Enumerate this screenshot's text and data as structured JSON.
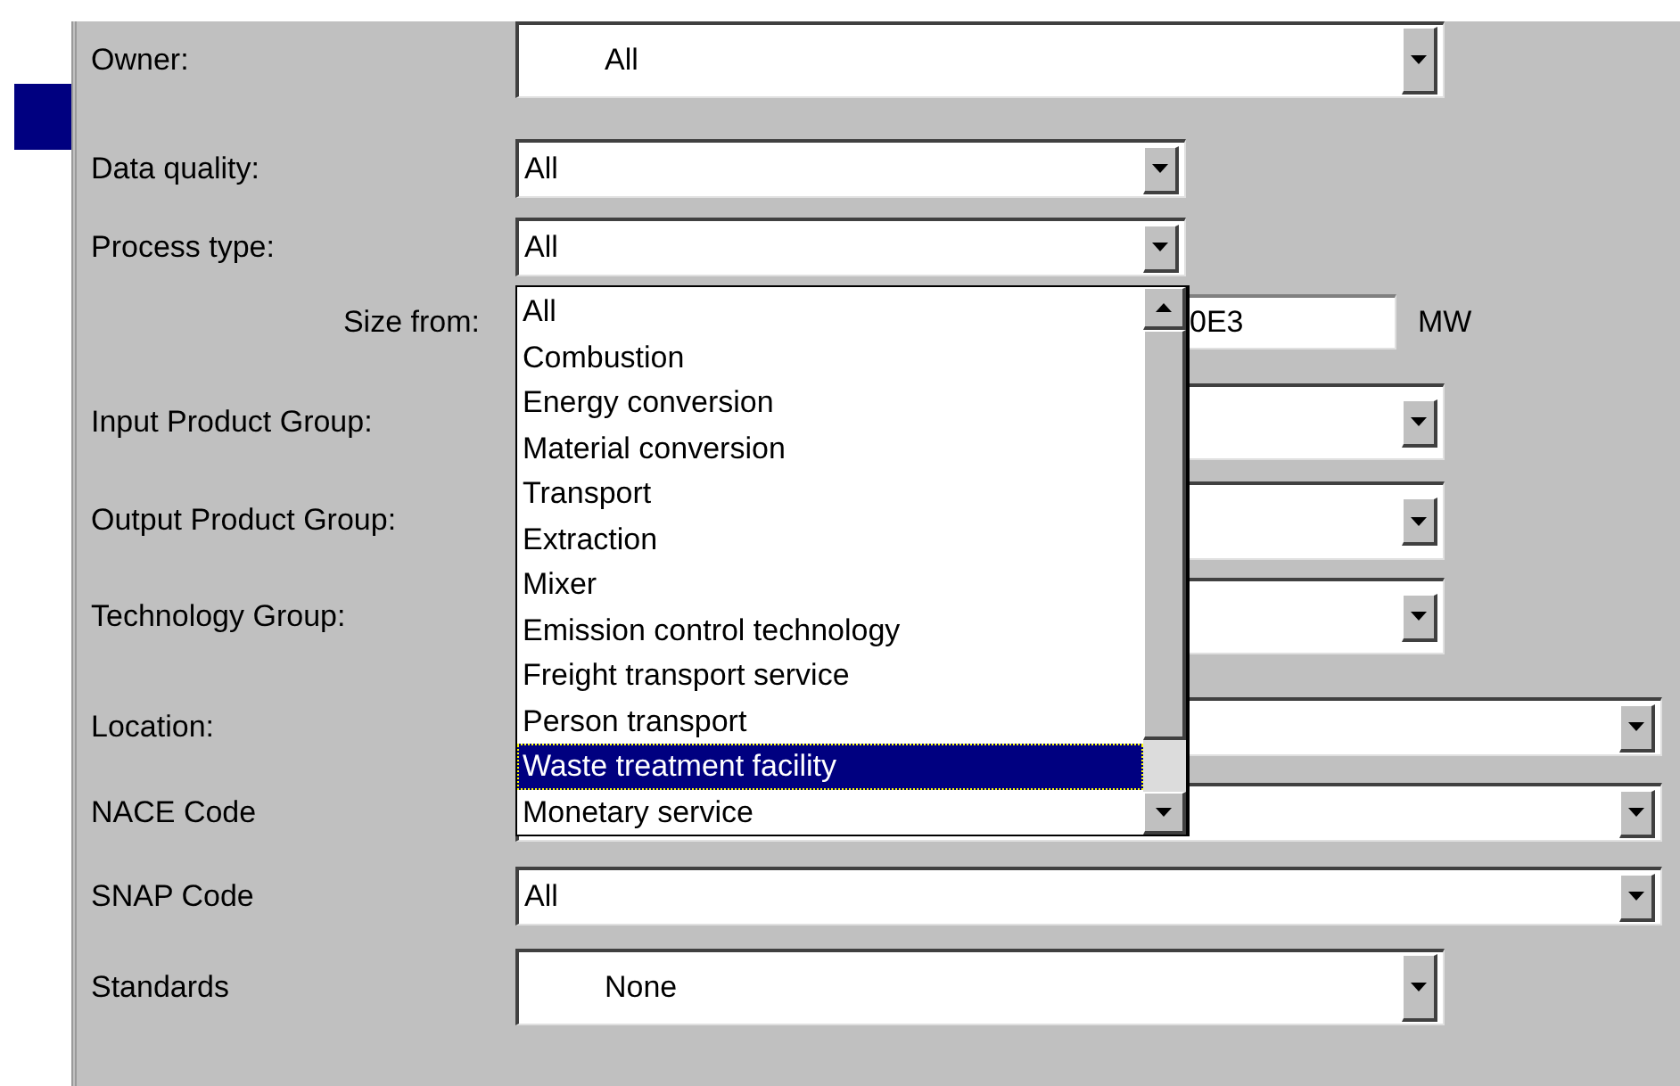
{
  "fields": [
    {
      "label": "Owner:",
      "kind": "combo",
      "value": "All"
    },
    {
      "label": "Data quality:",
      "kind": "combo",
      "value": "All"
    },
    {
      "label": "Process type:",
      "kind": "combo",
      "value": "All",
      "open": true
    },
    {
      "label": "Size from:",
      "kind": "text",
      "value": "0E3",
      "unit": "MW"
    },
    {
      "label": "Input Product Group:",
      "kind": "combo"
    },
    {
      "label": "Output Product Group:",
      "kind": "combo"
    },
    {
      "label": "Technology Group:",
      "kind": "combo"
    },
    {
      "label": "Location:",
      "kind": "combo"
    },
    {
      "label": "NACE Code",
      "kind": "combo"
    },
    {
      "label": "SNAP Code",
      "kind": "combo",
      "value": "All"
    },
    {
      "label": "Standards",
      "kind": "combo",
      "value": "None"
    }
  ],
  "dropdown": {
    "options": [
      {
        "label": "All",
        "selected": false
      },
      {
        "label": "Combustion",
        "selected": false
      },
      {
        "label": "Energy conversion",
        "selected": false
      },
      {
        "label": "Material conversion",
        "selected": false
      },
      {
        "label": "Transport",
        "selected": false
      },
      {
        "label": "Extraction",
        "selected": false
      },
      {
        "label": "Mixer",
        "selected": false
      },
      {
        "label": "Emission control technology",
        "selected": false
      },
      {
        "label": "Freight transport service",
        "selected": false
      },
      {
        "label": "Person transport",
        "selected": false
      },
      {
        "label": "Waste treatment facility",
        "selected": true
      },
      {
        "label": "Monetary service",
        "selected": false
      }
    ]
  }
}
